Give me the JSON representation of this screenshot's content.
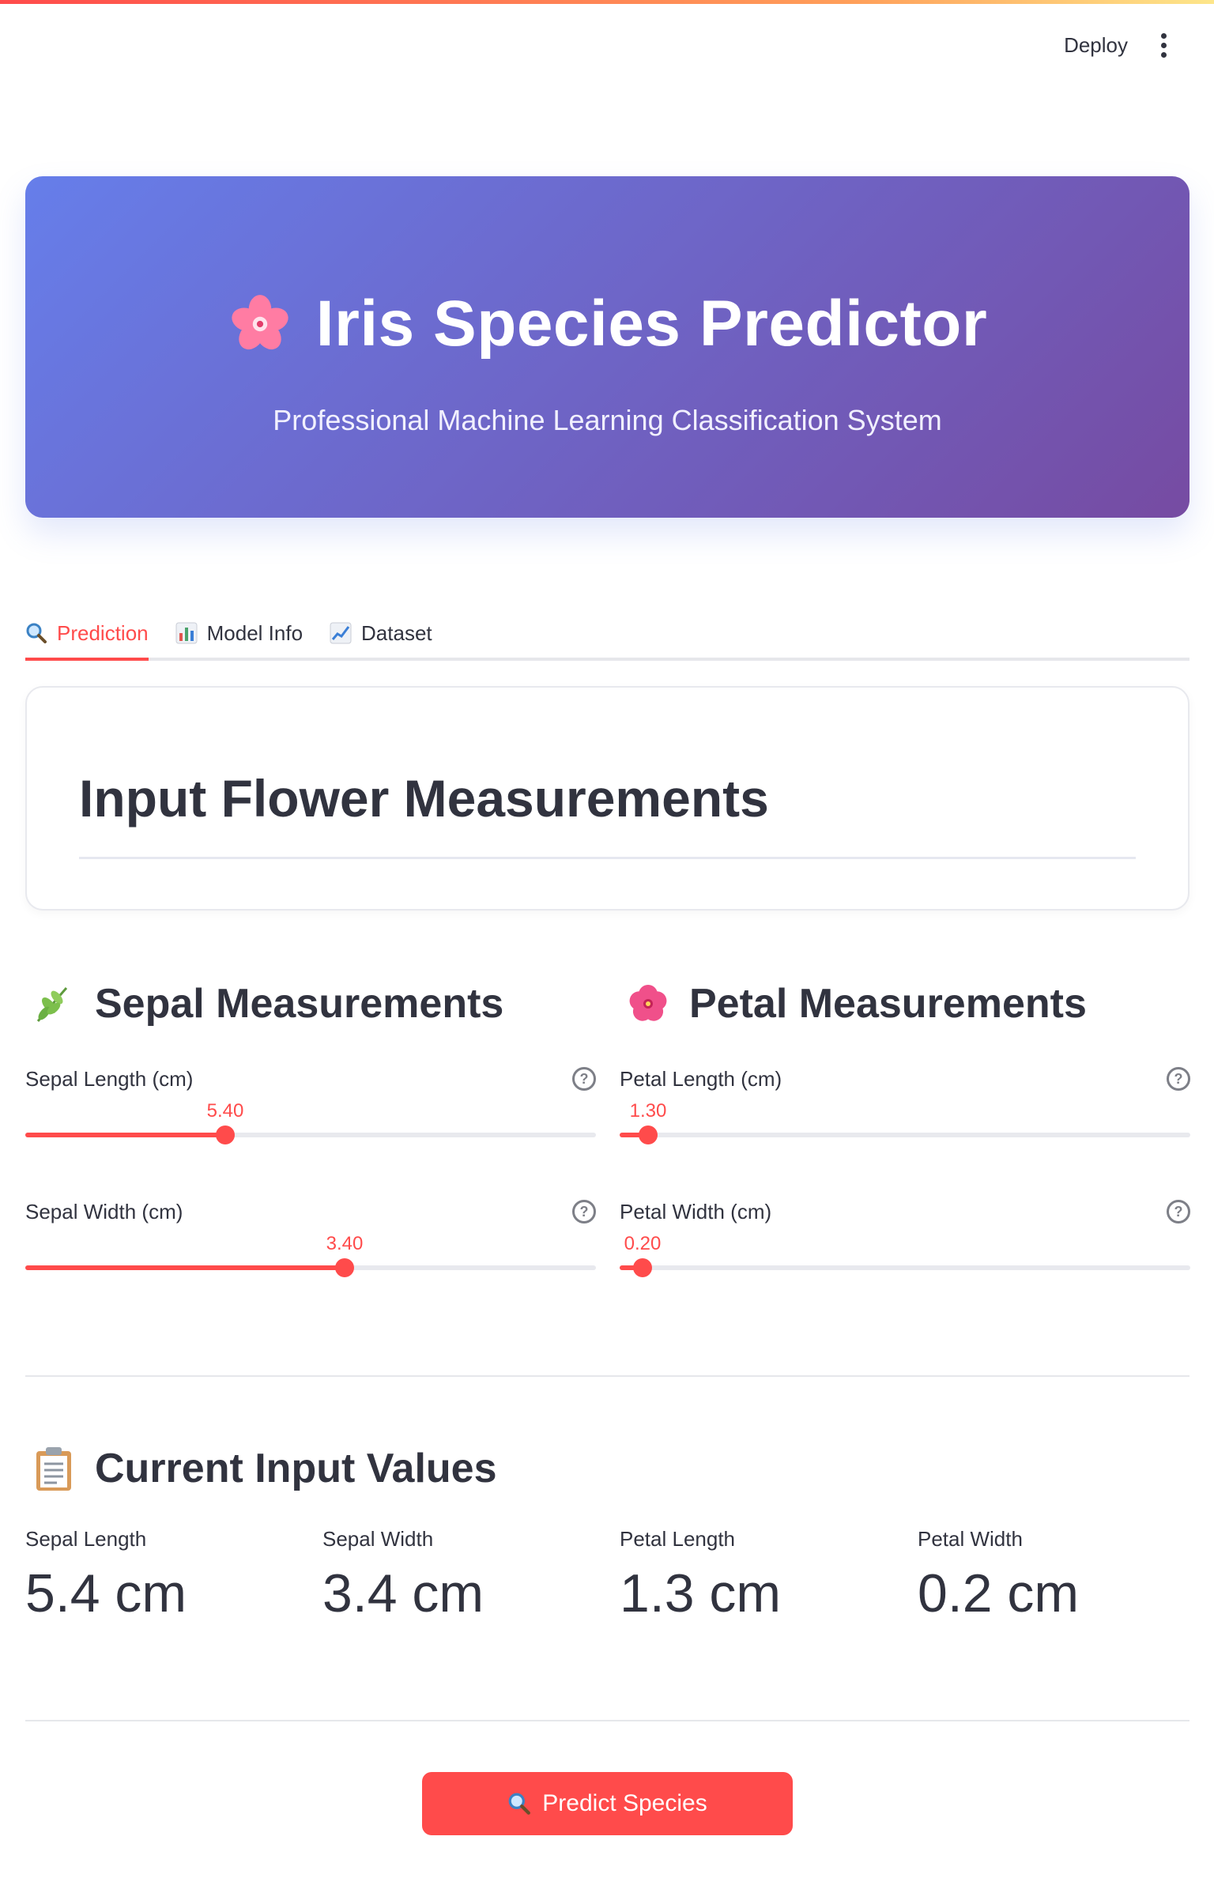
{
  "toolbar": {
    "deploy_label": "Deploy"
  },
  "hero": {
    "title": "Iris Species Predictor",
    "subtitle": "Professional Machine Learning Classification System"
  },
  "tabs": [
    {
      "label": "Prediction",
      "icon": "magnifier-icon",
      "active": true
    },
    {
      "label": "Model Info",
      "icon": "bar-chart-icon",
      "active": false
    },
    {
      "label": "Dataset",
      "icon": "line-chart-icon",
      "active": false
    }
  ],
  "input_card": {
    "title": "Input Flower Measurements"
  },
  "sepal": {
    "heading": "Sepal Measurements",
    "sliders": [
      {
        "label": "Sepal Length (cm)",
        "value": "5.40",
        "fraction": 0.35
      },
      {
        "label": "Sepal Width (cm)",
        "value": "3.40",
        "fraction": 0.56
      }
    ]
  },
  "petal": {
    "heading": "Petal Measurements",
    "sliders": [
      {
        "label": "Petal Length (cm)",
        "value": "1.30",
        "fraction": 0.05
      },
      {
        "label": "Petal Width (cm)",
        "value": "0.20",
        "fraction": 0.04
      }
    ]
  },
  "current": {
    "heading": "Current Input Values",
    "metrics": [
      {
        "label": "Sepal Length",
        "value": "5.4 cm"
      },
      {
        "label": "Sepal Width",
        "value": "3.4 cm"
      },
      {
        "label": "Petal Length",
        "value": "1.3 cm"
      },
      {
        "label": "Petal Width",
        "value": "0.2 cm"
      }
    ]
  },
  "predict_button": {
    "label": "Predict Species"
  },
  "colors": {
    "accent": "#ff4b4b",
    "hero_start": "#667eea",
    "hero_end": "#764ba2"
  }
}
